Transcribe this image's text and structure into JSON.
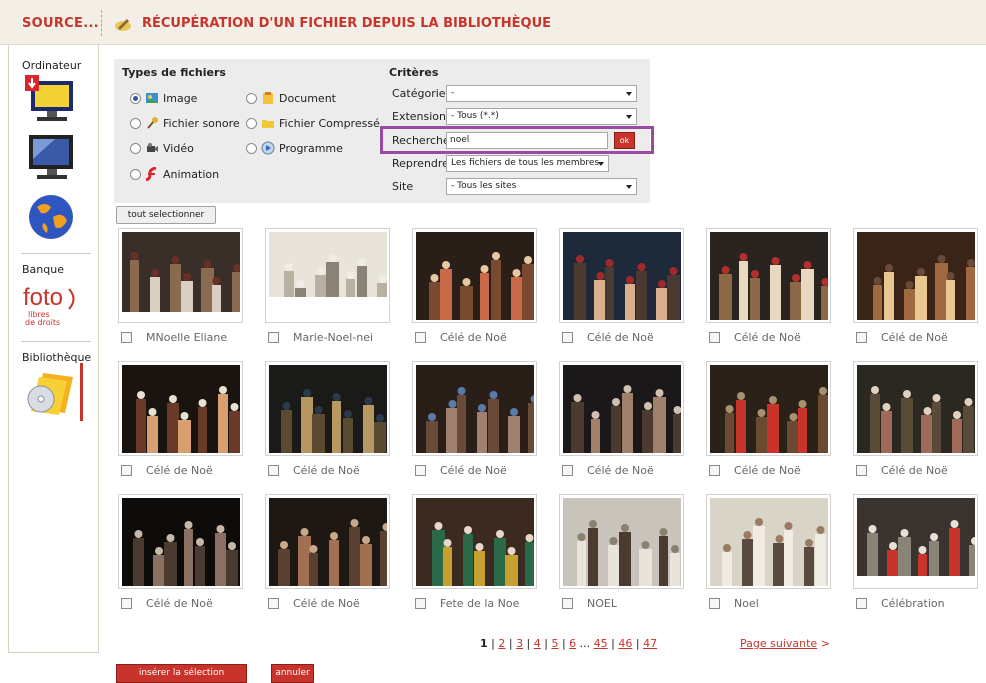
{
  "header": {
    "source_title": "SOURCE...",
    "page_title": "RÉCUPÉRATION D'UN FICHIER DEPUIS LA BIBLIOTHÈQUE"
  },
  "sidebar": {
    "computer_label": "Ordinateur",
    "bank_label": "Banque",
    "library_label": "Bibliothèque",
    "foto_main": "foto",
    "foto_sub1": "libres",
    "foto_sub2": "de droits"
  },
  "filters": {
    "types_title": "Types de fichiers",
    "types": {
      "image": "Image",
      "document": "Document",
      "sound": "Fichier sonore",
      "compressed": "Fichier Compressé",
      "video": "Vidéo",
      "program": "Programme",
      "animation": "Animation"
    },
    "selected_type": "Image",
    "criteria_title": "Critères",
    "category_label": "Catégorie",
    "category_value": "-",
    "extension_label": "Extension",
    "extension_value": "- Tous (*.*)",
    "search_label": "Recherche",
    "search_value": "noel",
    "ok_label": "ok",
    "reprendre_label": "Reprendre",
    "reprendre_value": "Les fichiers de tous les membres",
    "site_label": "Site",
    "site_value": "- Tous les sites"
  },
  "select_all_label": "tout selectionner",
  "images": [
    {
      "caption": "MNoelle Eliane"
    },
    {
      "caption": "Marie-Noel-nei"
    },
    {
      "caption": "Célé de Noë"
    },
    {
      "caption": "Célé de Noë"
    },
    {
      "caption": "Célé de Noë"
    },
    {
      "caption": "Célé de Noë"
    },
    {
      "caption": "Célé de Noë"
    },
    {
      "caption": "Célé de Noë"
    },
    {
      "caption": "Célé de Noë"
    },
    {
      "caption": "Célé de Noë"
    },
    {
      "caption": "Célé de Noë"
    },
    {
      "caption": "Célé de Noë"
    },
    {
      "caption": "Célé de Noë"
    },
    {
      "caption": "Célé de Noë"
    },
    {
      "caption": "Fete de la Noe"
    },
    {
      "caption": "NOEL"
    },
    {
      "caption": "Noel"
    },
    {
      "caption": "Célébration"
    }
  ],
  "pagination": {
    "current": "1",
    "pages": [
      "2",
      "3",
      "4",
      "5",
      "6"
    ],
    "ellipsis": "...",
    "last_pages": [
      "45",
      "46",
      "47"
    ],
    "next_label": "Page suivante",
    "next_arrow": ">"
  },
  "actions": {
    "insert_label": "insérer la sélection",
    "cancel_label": "annuler"
  },
  "colors": {
    "accent": "#c8342b",
    "highlight": "#9a4aa0",
    "panel": "#ececec"
  }
}
